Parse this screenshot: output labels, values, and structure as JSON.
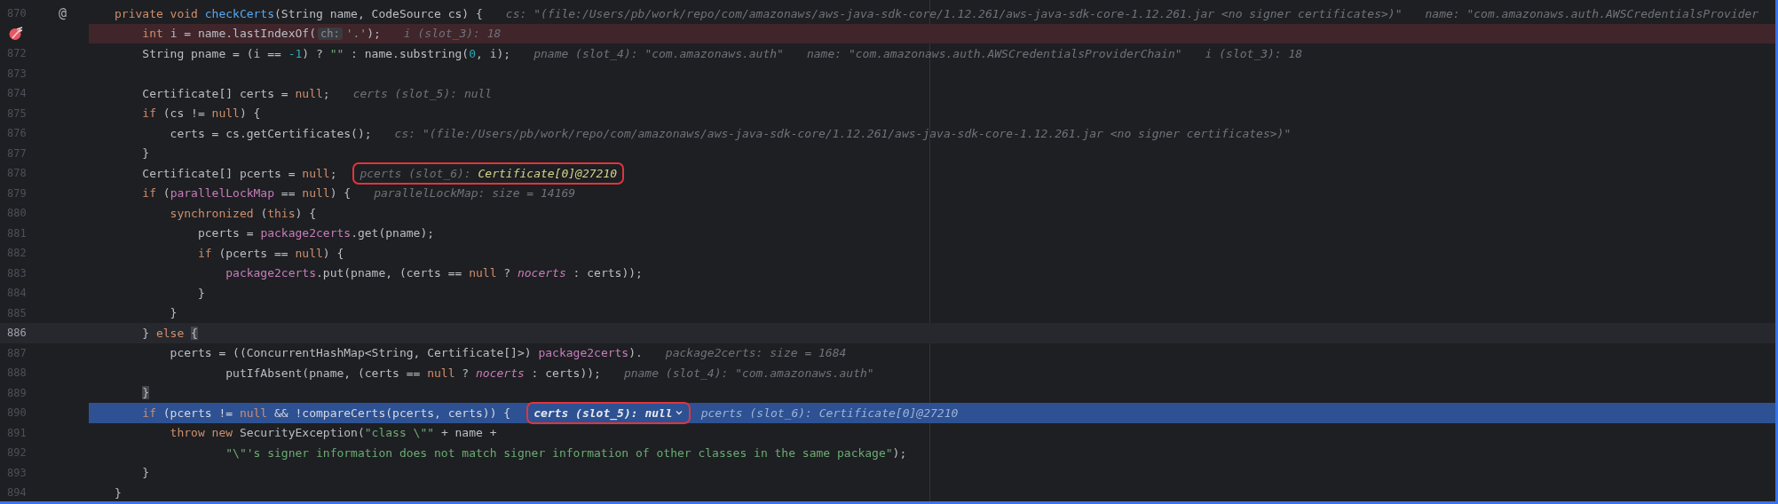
{
  "editor": {
    "lines": [
      {
        "number": "870",
        "gutter_mark": "@",
        "segments": [
          {
            "text": "private void ",
            "kind": "kw"
          },
          {
            "text": "checkCerts",
            "kind": "fn"
          },
          {
            "text": "(String name, CodeSource cs) {",
            "kind": "plain"
          }
        ],
        "hints": [
          {
            "label": "cs:",
            "value": "\"(file:/Users/pb/work/repo/com/amazonaws/aws-java-sdk-core/1.12.261/aws-java-sdk-core-1.12.261.jar <no signer certificates>)\"",
            "changed": false,
            "boxed": false,
            "expandable": false
          },
          {
            "label": "name:",
            "value": "\"com.amazonaws.auth.AWSCredentialsProvider",
            "changed": false,
            "boxed": false,
            "expandable": false
          }
        ]
      },
      {
        "breakpoint": true,
        "segments": [
          {
            "text": "    int ",
            "kind": "kw"
          },
          {
            "text": "i = name.lastIndexOf(",
            "kind": "plain"
          },
          {
            "text": "ch:",
            "kind": "param"
          },
          {
            "text": "'.'",
            "kind": "str"
          },
          {
            "text": ");",
            "kind": "plain"
          }
        ],
        "hints": [
          {
            "label": "i (slot_3):",
            "value": "18",
            "changed": false,
            "boxed": false,
            "expandable": false
          }
        ]
      },
      {
        "number": "872",
        "segments": [
          {
            "text": "    String pname = (i == ",
            "kind": "plain"
          },
          {
            "text": "-1",
            "kind": "num"
          },
          {
            "text": ") ? ",
            "kind": "plain"
          },
          {
            "text": "\"\"",
            "kind": "str"
          },
          {
            "text": " : name.substring(",
            "kind": "plain"
          },
          {
            "text": "0",
            "kind": "num"
          },
          {
            "text": ", i);",
            "kind": "plain"
          }
        ],
        "hints": [
          {
            "label": "pname (slot_4):",
            "value": "\"com.amazonaws.auth\"",
            "changed": false,
            "boxed": false,
            "expandable": false
          },
          {
            "label": "name:",
            "value": "\"com.amazonaws.auth.AWSCredentialsProviderChain\"",
            "changed": false,
            "boxed": false,
            "expandable": false
          },
          {
            "label": "i (slot_3):",
            "value": "18",
            "changed": false,
            "boxed": false,
            "expandable": false
          }
        ]
      },
      {
        "number": "873"
      },
      {
        "number": "874",
        "segments": [
          {
            "text": "    Certificate[] certs = ",
            "kind": "plain"
          },
          {
            "text": "null",
            "kind": "kw"
          },
          {
            "text": ";",
            "kind": "plain"
          }
        ],
        "hints": [
          {
            "label": "certs (slot_5):",
            "value": "null",
            "changed": false,
            "boxed": false,
            "expandable": false
          }
        ]
      },
      {
        "number": "875",
        "segments": [
          {
            "text": "    if ",
            "kind": "kw"
          },
          {
            "text": "(cs != ",
            "kind": "plain"
          },
          {
            "text": "null",
            "kind": "kw"
          },
          {
            "text": ") {",
            "kind": "plain"
          }
        ]
      },
      {
        "number": "876",
        "segments": [
          {
            "text": "        certs = cs.getCertificates();",
            "kind": "plain"
          }
        ],
        "hints": [
          {
            "label": "cs:",
            "value": "\"(file:/Users/pb/work/repo/com/amazonaws/aws-java-sdk-core/1.12.261/aws-java-sdk-core-1.12.261.jar <no signer certificates>)\"",
            "changed": false,
            "boxed": false,
            "expandable": false
          }
        ]
      },
      {
        "number": "877",
        "segments": [
          {
            "text": "    }",
            "kind": "plain"
          }
        ]
      },
      {
        "number": "878",
        "segments": [
          {
            "text": "    Certificate[] pcerts = ",
            "kind": "plain"
          },
          {
            "text": "null",
            "kind": "kw"
          },
          {
            "text": ";",
            "kind": "plain"
          }
        ],
        "hints": [
          {
            "label": "pcerts (slot_6):",
            "value": "Certificate[0]@27210",
            "changed": true,
            "boxed": true,
            "expandable": false
          }
        ]
      },
      {
        "number": "879",
        "segments": [
          {
            "text": "    if ",
            "kind": "kw"
          },
          {
            "text": "(",
            "kind": "plain"
          },
          {
            "text": "parallelLockMap",
            "kind": "field"
          },
          {
            "text": " == ",
            "kind": "plain"
          },
          {
            "text": "null",
            "kind": "kw"
          },
          {
            "text": ") {",
            "kind": "plain"
          }
        ],
        "hints": [
          {
            "label": "parallelLockMap:",
            "value": "size = 14169",
            "changed": false,
            "boxed": false,
            "expandable": false
          }
        ]
      },
      {
        "number": "880",
        "segments": [
          {
            "text": "        synchronized ",
            "kind": "kw"
          },
          {
            "text": "(",
            "kind": "plain"
          },
          {
            "text": "this",
            "kind": "kw"
          },
          {
            "text": ") {",
            "kind": "plain"
          }
        ]
      },
      {
        "number": "881",
        "segments": [
          {
            "text": "            pcerts = ",
            "kind": "plain"
          },
          {
            "text": "package2certs",
            "kind": "field"
          },
          {
            "text": ".get(pname);",
            "kind": "plain"
          }
        ]
      },
      {
        "number": "882",
        "segments": [
          {
            "text": "            if ",
            "kind": "kw"
          },
          {
            "text": "(pcerts == ",
            "kind": "plain"
          },
          {
            "text": "null",
            "kind": "kw"
          },
          {
            "text": ") {",
            "kind": "plain"
          }
        ]
      },
      {
        "number": "883",
        "segments": [
          {
            "text": "                package2certs",
            "kind": "field"
          },
          {
            "text": ".put(pname, (certs == ",
            "kind": "plain"
          },
          {
            "text": "null",
            "kind": "kw"
          },
          {
            "text": " ? ",
            "kind": "plain"
          },
          {
            "text": "nocerts",
            "kind": "static"
          },
          {
            "text": " : certs));",
            "kind": "plain"
          }
        ]
      },
      {
        "number": "884",
        "segments": [
          {
            "text": "            }",
            "kind": "plain"
          }
        ]
      },
      {
        "number": "885",
        "segments": [
          {
            "text": "        }",
            "kind": "plain"
          }
        ]
      },
      {
        "number": "886",
        "caret": true,
        "segments": [
          {
            "text": "    } ",
            "kind": "plain"
          },
          {
            "text": "else ",
            "kind": "kw"
          },
          {
            "text": "{",
            "kind": "brace"
          }
        ]
      },
      {
        "number": "887",
        "segments": [
          {
            "text": "        pcerts = ((ConcurrentHashMap<String, Certificate[]>) ",
            "kind": "plain"
          },
          {
            "text": "package2certs",
            "kind": "field"
          },
          {
            "text": ").",
            "kind": "plain"
          }
        ],
        "hints": [
          {
            "label": "package2certs:",
            "value": "size = 1684",
            "changed": false,
            "boxed": false,
            "expandable": false
          }
        ]
      },
      {
        "number": "888",
        "segments": [
          {
            "text": "                putIfAbsent(pname, (certs == ",
            "kind": "plain"
          },
          {
            "text": "null",
            "kind": "kw"
          },
          {
            "text": " ? ",
            "kind": "plain"
          },
          {
            "text": "nocerts",
            "kind": "static"
          },
          {
            "text": " : certs));",
            "kind": "plain"
          }
        ],
        "hints": [
          {
            "label": "pname (slot_4):",
            "value": "\"com.amazonaws.auth\"",
            "changed": false,
            "boxed": false,
            "expandable": false
          }
        ]
      },
      {
        "number": "889",
        "segments": [
          {
            "text": "    }",
            "kind": "brace"
          }
        ]
      },
      {
        "number": "890",
        "execution_point": true,
        "segments": [
          {
            "text": "    if ",
            "kind": "kw"
          },
          {
            "text": "(pcerts != ",
            "kind": "plain"
          },
          {
            "text": "null",
            "kind": "kw"
          },
          {
            "text": " && !compareCerts(pcerts, certs)) {",
            "kind": "plain"
          }
        ],
        "hints": [
          {
            "label": "certs (slot_5):",
            "value": "null",
            "changed": false,
            "boxed": true,
            "expandable": true
          },
          {
            "label": "pcerts (slot_6):",
            "value": "Certificate[0]@27210",
            "changed": false,
            "boxed": false,
            "expandable": false
          }
        ]
      },
      {
        "number": "891",
        "segments": [
          {
            "text": "        throw new ",
            "kind": "kw"
          },
          {
            "text": "SecurityException(",
            "kind": "plain"
          },
          {
            "text": "\"class \\\"\"",
            "kind": "str"
          },
          {
            "text": " + name +",
            "kind": "plain"
          }
        ]
      },
      {
        "number": "892",
        "segments": [
          {
            "text": "                \"\\\"'s signer information does not match signer information of other classes in the same package\"",
            "kind": "str"
          },
          {
            "text": ");",
            "kind": "plain"
          }
        ]
      },
      {
        "number": "893",
        "segments": [
          {
            "text": "    }",
            "kind": "plain"
          }
        ]
      },
      {
        "number": "894",
        "segments": [
          {
            "text": "}",
            "kind": "plain"
          }
        ]
      }
    ]
  }
}
